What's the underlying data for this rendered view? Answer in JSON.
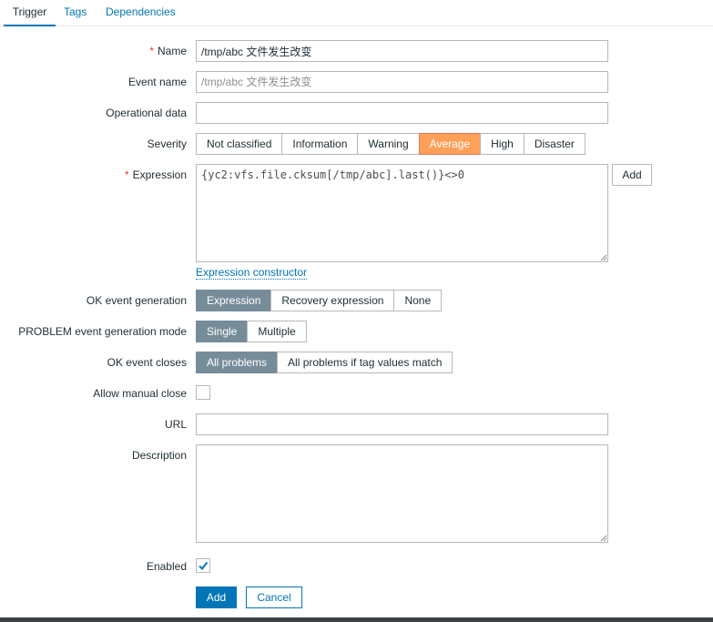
{
  "tabs": [
    "Trigger",
    "Tags",
    "Dependencies"
  ],
  "form": {
    "name": {
      "label": "Name",
      "value": "/tmp/abc 文件发生改变"
    },
    "event_name": {
      "label": "Event name",
      "placeholder": "/tmp/abc 文件发生改变"
    },
    "operational_data": {
      "label": "Operational data",
      "value": ""
    },
    "severity": {
      "label": "Severity",
      "options": [
        "Not classified",
        "Information",
        "Warning",
        "Average",
        "High",
        "Disaster"
      ],
      "selected": "Average"
    },
    "expression": {
      "label": "Expression",
      "value": "{yc2:vfs.file.cksum[/tmp/abc].last()}<>0",
      "add_label": "Add",
      "constructor_link": "Expression constructor"
    },
    "ok_event_generation": {
      "label": "OK event generation",
      "options": [
        "Expression",
        "Recovery expression",
        "None"
      ],
      "selected": "Expression"
    },
    "problem_mode": {
      "label": "PROBLEM event generation mode",
      "options": [
        "Single",
        "Multiple"
      ],
      "selected": "Single"
    },
    "ok_event_closes": {
      "label": "OK event closes",
      "options": [
        "All problems",
        "All problems if tag values match"
      ],
      "selected": "All problems"
    },
    "allow_manual_close": {
      "label": "Allow manual close",
      "checked": false
    },
    "url": {
      "label": "URL",
      "value": ""
    },
    "description": {
      "label": "Description",
      "value": ""
    },
    "enabled": {
      "label": "Enabled",
      "checked": true
    }
  },
  "actions": {
    "add": "Add",
    "cancel": "Cancel"
  },
  "colors": {
    "accent": "#0275b8",
    "selected_segment": "#768d99",
    "severity_average": "#ffa059",
    "required": "#e33734"
  }
}
